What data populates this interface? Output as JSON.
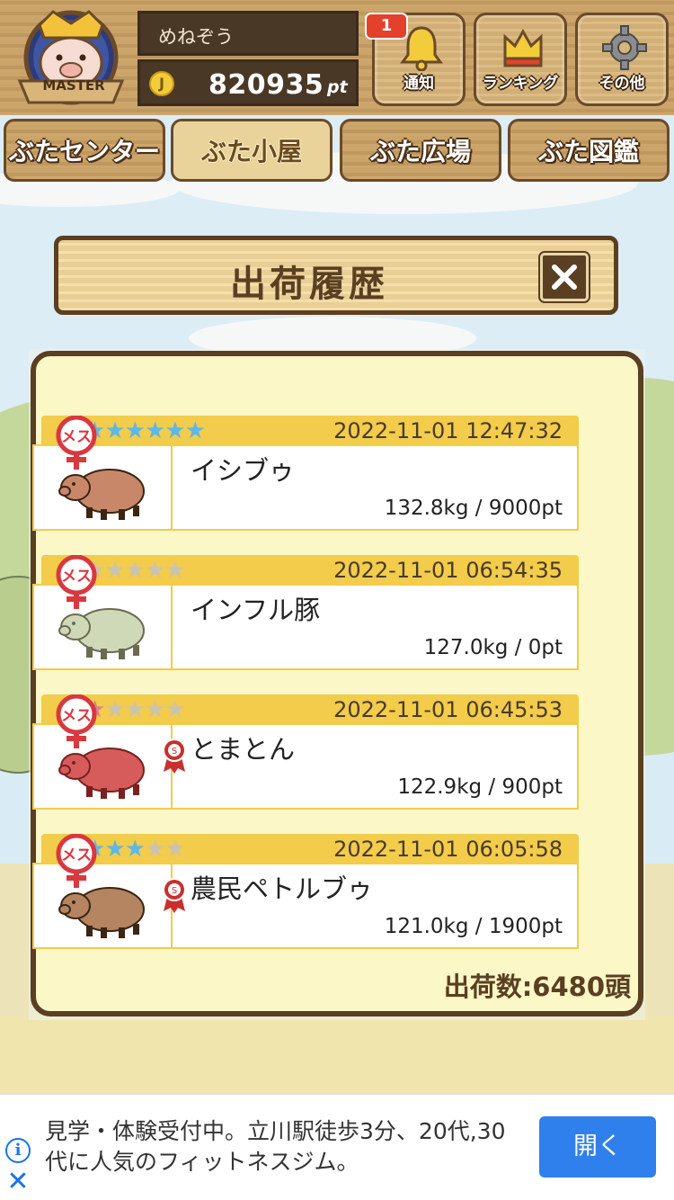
{
  "header": {
    "user_name": "めねぞう",
    "points": "820935",
    "points_unit": "pt",
    "rank_badge": "MASTER",
    "notification_count": "1",
    "buttons": [
      {
        "label": "通知",
        "icon": "bell-icon"
      },
      {
        "label": "ランキング",
        "icon": "crown-icon"
      },
      {
        "label": "その他",
        "icon": "gear-icon"
      }
    ]
  },
  "tabs": [
    {
      "label": "ぶたセンター",
      "active": false
    },
    {
      "label": "ぶた小屋",
      "active": true
    },
    {
      "label": "ぶた広場",
      "active": false
    },
    {
      "label": "ぶた図鑑",
      "active": false
    }
  ],
  "dialog": {
    "title": "出荷履歴",
    "close_icon": "close-icon"
  },
  "entries": [
    {
      "gender": "メス",
      "stars_filled": 6,
      "stars_total": 6,
      "star_color": "#5db8e8",
      "date": "2022-11-01 12:47:32",
      "name": "イシブゥ",
      "stats": "132.8kg / 9000pt",
      "medal": false
    },
    {
      "gender": "メス",
      "stars_filled": 0,
      "stars_total": 5,
      "star_color": "#c9c3b3",
      "date": "2022-11-01 06:54:35",
      "name": "インフル豚",
      "stats": "127.0kg / 0pt",
      "medal": false
    },
    {
      "gender": "メス",
      "stars_filled": 1,
      "stars_total": 5,
      "star_color": "#e07a93",
      "date": "2022-11-01 06:45:53",
      "name": "とまとん",
      "stats": "122.9kg / 900pt",
      "medal": true
    },
    {
      "gender": "メス",
      "stars_filled": 3,
      "stars_total": 5,
      "star_color": "#5db8e8",
      "date": "2022-11-01 06:05:58",
      "name": "農民ペトルブゥ",
      "stats": "121.0kg / 1900pt",
      "medal": true
    }
  ],
  "total_shipped": "出荷数:6480頭",
  "ad": {
    "text": "見学・体験受付中。立川駅徒歩3分、20代,30代に人気のフィットネスジム。",
    "button_label": "開く",
    "info_icon": "info-icon",
    "close_icon": "close-icon"
  },
  "colors": {
    "wood": "#c9a064",
    "dark_wood": "#5a3f22",
    "panel_bg": "#fcf7c7",
    "entry_header": "#f2cc4a",
    "ad_button": "#2f80ed"
  }
}
